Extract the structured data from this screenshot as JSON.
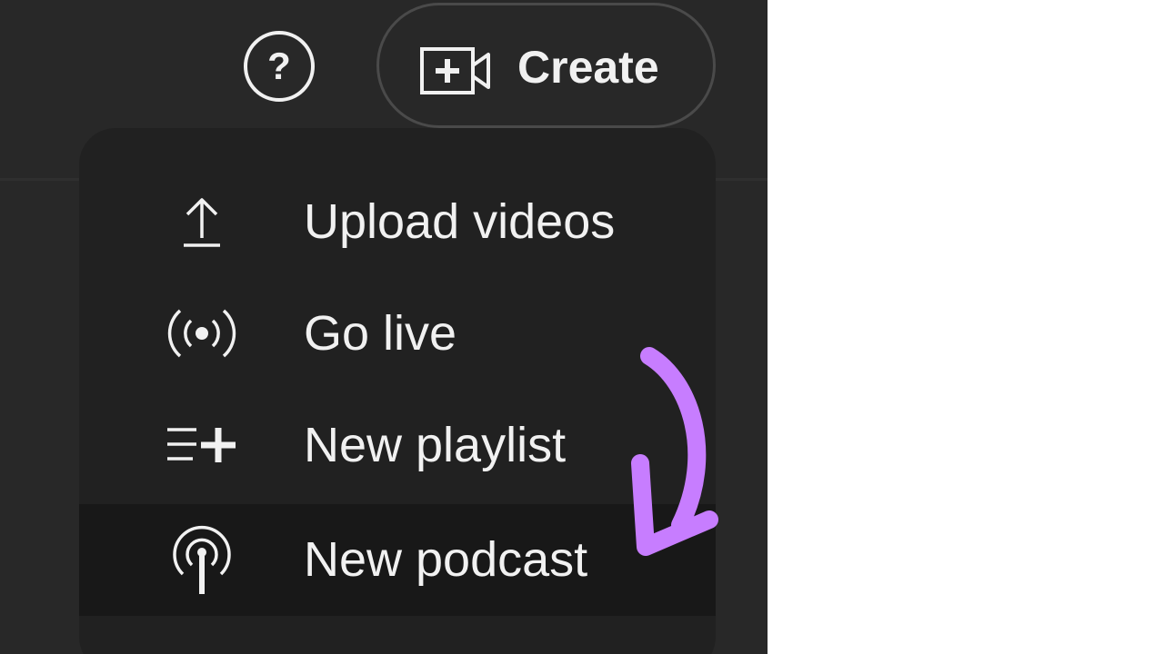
{
  "header": {
    "help_button": {
      "icon": "help-circle-icon",
      "glyph": "?"
    },
    "create_button": {
      "icon": "video-camera-plus-icon",
      "label": "Create"
    }
  },
  "create_menu": {
    "items": [
      {
        "label": "Upload videos",
        "icon": "upload-icon"
      },
      {
        "label": "Go live",
        "icon": "broadcast-icon"
      },
      {
        "label": "New playlist",
        "icon": "playlist-add-icon"
      },
      {
        "label": "New podcast",
        "icon": "podcast-icon",
        "selected": true
      }
    ]
  },
  "annotation": {
    "icon": "curved-arrow-icon",
    "color": "#c77dff"
  },
  "colors": {
    "background": "#282828",
    "menu_background": "#212121",
    "menu_selected": "#181818",
    "text": "#f1f1f1",
    "canvas": "#ffffff"
  }
}
